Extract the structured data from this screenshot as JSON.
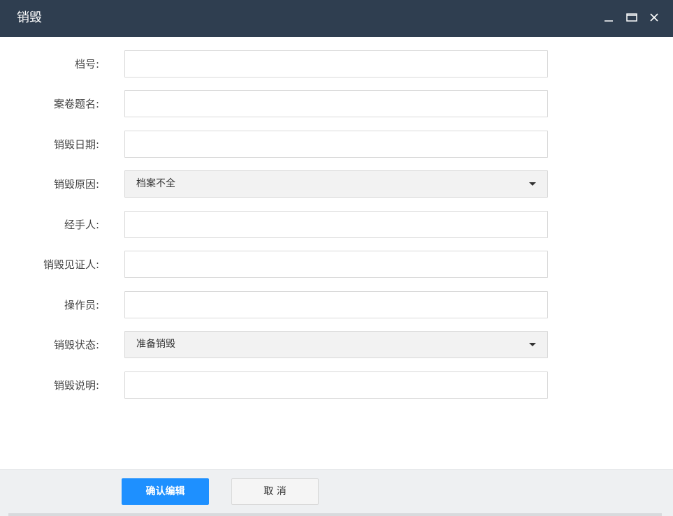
{
  "window": {
    "title": "销毁",
    "controls": {
      "minimize_icon": "minimize-icon",
      "maximize_icon": "maximize-icon",
      "close_icon": "close-icon"
    },
    "titlebar_color": "#2f3e50"
  },
  "form": {
    "fields": [
      {
        "label": "档号:",
        "type": "text",
        "value": ""
      },
      {
        "label": "案卷题名:",
        "type": "text",
        "value": ""
      },
      {
        "label": "销毁日期:",
        "type": "text",
        "value": ""
      },
      {
        "label": "销毁原因:",
        "type": "select",
        "value": "档案不全"
      },
      {
        "label": "经手人:",
        "type": "text",
        "value": ""
      },
      {
        "label": "销毁见证人:",
        "type": "text",
        "value": ""
      },
      {
        "label": "操作员:",
        "type": "text",
        "value": ""
      },
      {
        "label": "销毁状态:",
        "type": "select",
        "value": "准备销毁"
      },
      {
        "label": "销毁说明:",
        "type": "text",
        "value": ""
      }
    ]
  },
  "footer": {
    "confirm_label": "确认编辑",
    "cancel_label": "取 消",
    "primary_color": "#1e90ff"
  }
}
